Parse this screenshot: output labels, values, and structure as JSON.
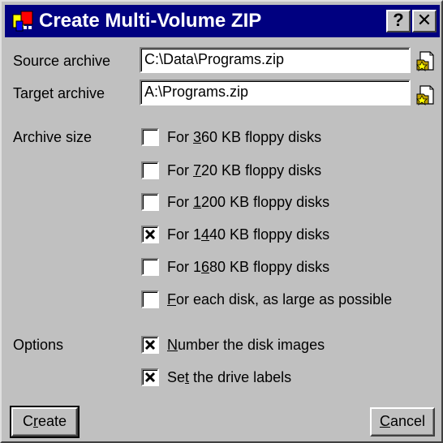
{
  "window": {
    "title": "Create Multi-Volume ZIP",
    "help_glyph": "?",
    "close_glyph": "✕"
  },
  "source": {
    "label_pre": "Source archive",
    "value": "C:\\Data\\Programs.zip"
  },
  "target": {
    "label_pre": "Target archive",
    "value": "A:\\Programs.zip"
  },
  "size": {
    "label": "Archive size",
    "options": [
      {
        "pre": "For ",
        "key": "3",
        "post": "60 KB floppy disks",
        "checked": false
      },
      {
        "pre": "For ",
        "key": "7",
        "post": "20 KB floppy disks",
        "checked": false
      },
      {
        "pre": "For ",
        "key": "1",
        "post": "200 KB floppy disks",
        "checked": false
      },
      {
        "pre": "For 1",
        "key": "4",
        "post": "40 KB floppy disks",
        "checked": true
      },
      {
        "pre": "For 1",
        "key": "6",
        "post": "80 KB floppy disks",
        "checked": false
      },
      {
        "pre": "",
        "key": "F",
        "post": "or each disk, as large as possible",
        "checked": false
      }
    ]
  },
  "options": {
    "label": "Options",
    "items": [
      {
        "pre": "",
        "key": "N",
        "post": "umber the disk images",
        "checked": true
      },
      {
        "pre": "Se",
        "key": "t",
        "post": " the drive labels",
        "checked": true
      }
    ]
  },
  "buttons": {
    "create": {
      "pre": "C",
      "key": "r",
      "post": "eate"
    },
    "cancel": {
      "pre": "",
      "key": "C",
      "post": "ancel"
    }
  },
  "colors": {
    "titlebar": "#000080",
    "face": "#c0c0c0"
  },
  "icons": {
    "app": "zip-wizard-icon",
    "browse": "open-folder-star-icon"
  }
}
